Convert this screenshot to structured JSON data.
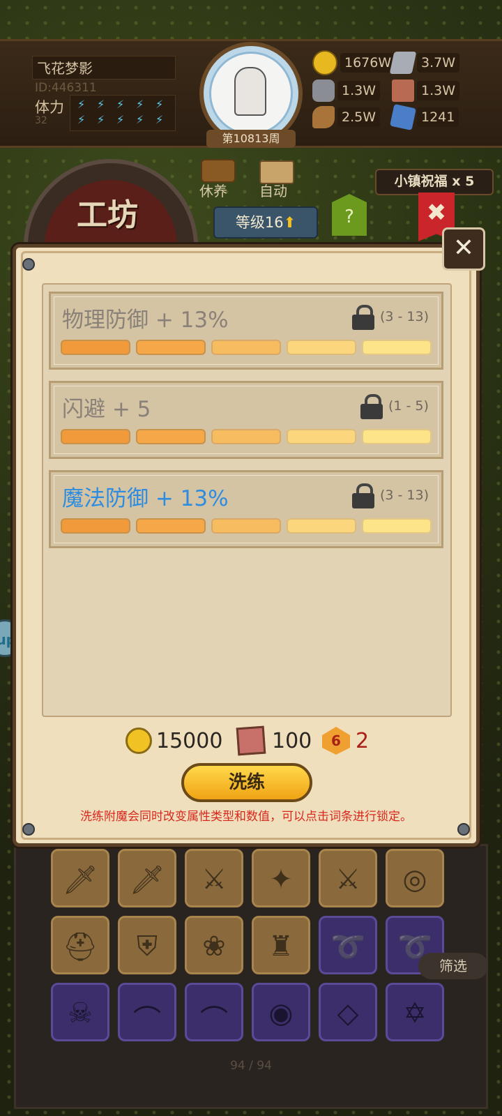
{
  "player": {
    "name": "飞花梦影",
    "id": "ID:446311",
    "stamina_label": "体力",
    "stamina_value": "32",
    "week": "第10813周"
  },
  "resources": [
    {
      "icon": "gold-coin-icon",
      "value": "1676W"
    },
    {
      "icon": "iron-ingot-icon",
      "value": "3.7W"
    },
    {
      "icon": "stone-icon",
      "value": "1.3W"
    },
    {
      "icon": "leather-icon",
      "value": "1.3W"
    },
    {
      "icon": "wood-log-icon",
      "value": "2.5W"
    },
    {
      "icon": "crystal-icon",
      "value": "1241"
    }
  ],
  "nav": {
    "workshop_title": "工坊",
    "rest_label": "休养",
    "auto_label": "自动",
    "level_label": "等级16",
    "help": "?",
    "blessing": "小镇祝福 x 5"
  },
  "dialog": {
    "stats": [
      {
        "name": "物理防御 + 13%",
        "range": "(3 - 13)",
        "highlight": false
      },
      {
        "name": "闪避 + 5",
        "range": "(1 - 5)",
        "highlight": false
      },
      {
        "name": "魔法防御 + 13%",
        "range": "(3 - 13)",
        "highlight": true
      }
    ],
    "cost": {
      "gold": "15000",
      "leather": "100",
      "dice": "2",
      "dice_face": "6"
    },
    "refine_button": "洗练",
    "hint": "洗练附魔会同时改变属性类型和数值，可以点击词条进行锁定。"
  },
  "side_bubble": "up",
  "inventory": {
    "filter_button": "筛选",
    "page_count": "94 / 94"
  },
  "colors": {
    "highlight_stat": "#2e8ce0",
    "hint_red": "#d8281e",
    "button_gold": "#f0a414"
  }
}
